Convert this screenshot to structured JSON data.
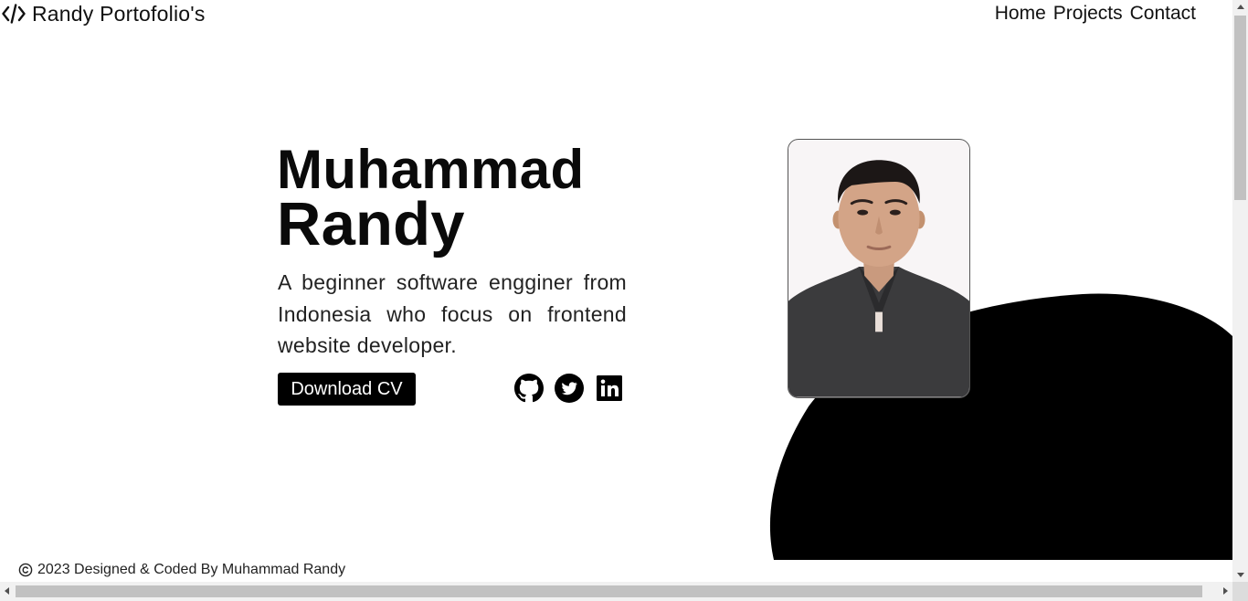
{
  "header": {
    "brand_icon": "code-icon",
    "brand_name": "Randy Portofolio's",
    "nav": [
      {
        "label": "Home"
      },
      {
        "label": "Projects"
      },
      {
        "label": "Contact"
      }
    ]
  },
  "hero": {
    "name_line1": "Muhammad",
    "name_line2": "Randy",
    "description": "A beginner software engginer from Indonesia who focus on frontend website developer.",
    "cv_button": "Download CV",
    "socials": [
      {
        "icon": "github-icon"
      },
      {
        "icon": "twitter-icon"
      },
      {
        "icon": "linkedin-icon"
      }
    ],
    "photo": "profile-photo"
  },
  "footer": {
    "icon": "copyright-icon",
    "text": "2023 Designed & Coded By Muhammad Randy"
  },
  "colors": {
    "background": "#ffffff",
    "accent": "#000000",
    "text": "#111111",
    "button_text": "#ffffff"
  }
}
